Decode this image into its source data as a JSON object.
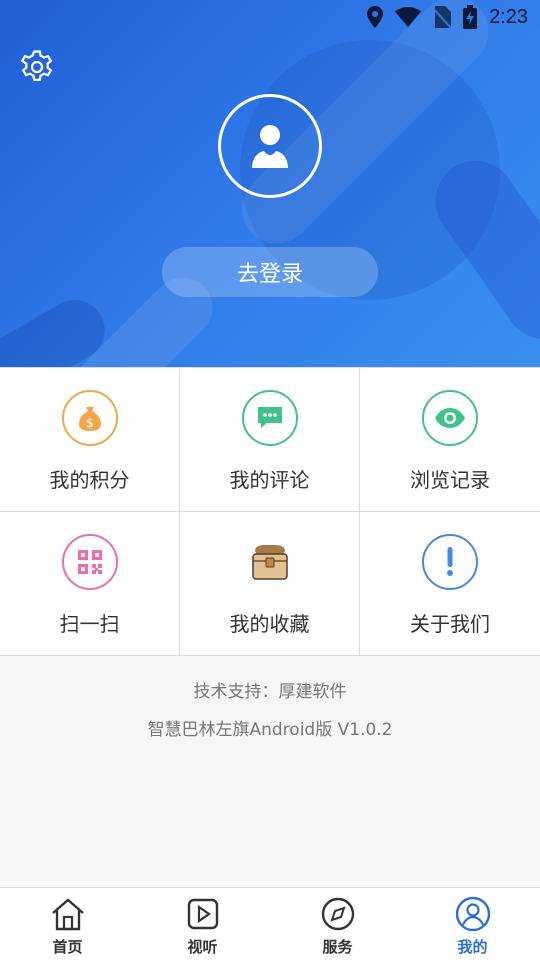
{
  "status_bar": {
    "time": "2:23"
  },
  "header": {
    "login_label": "去登录"
  },
  "grid": {
    "items": [
      {
        "label": "我的积分",
        "icon": "money-bag-icon",
        "color": "#f3a54a"
      },
      {
        "label": "我的评论",
        "icon": "comment-icon",
        "color": "#3fc38a"
      },
      {
        "label": "浏览记录",
        "icon": "eye-icon",
        "color": "#3fc38a"
      },
      {
        "label": "扫一扫",
        "icon": "qr-code-icon",
        "color": "#ef6cb0"
      },
      {
        "label": "我的收藏",
        "icon": "treasure-box-icon",
        "color": "#c89a5a"
      },
      {
        "label": "关于我们",
        "icon": "info-icon",
        "color": "#4b86e6"
      }
    ]
  },
  "footer": {
    "support": "技术支持：厚建软件",
    "version": "智慧巴林左旗Android版 V1.0.2"
  },
  "bottom_nav": {
    "active_color": "#2a6fd8",
    "items": [
      {
        "label": "首页",
        "icon": "home-icon"
      },
      {
        "label": "视听",
        "icon": "play-icon"
      },
      {
        "label": "服务",
        "icon": "compass-icon"
      },
      {
        "label": "我的",
        "icon": "user-circle-icon",
        "active": true
      }
    ]
  }
}
